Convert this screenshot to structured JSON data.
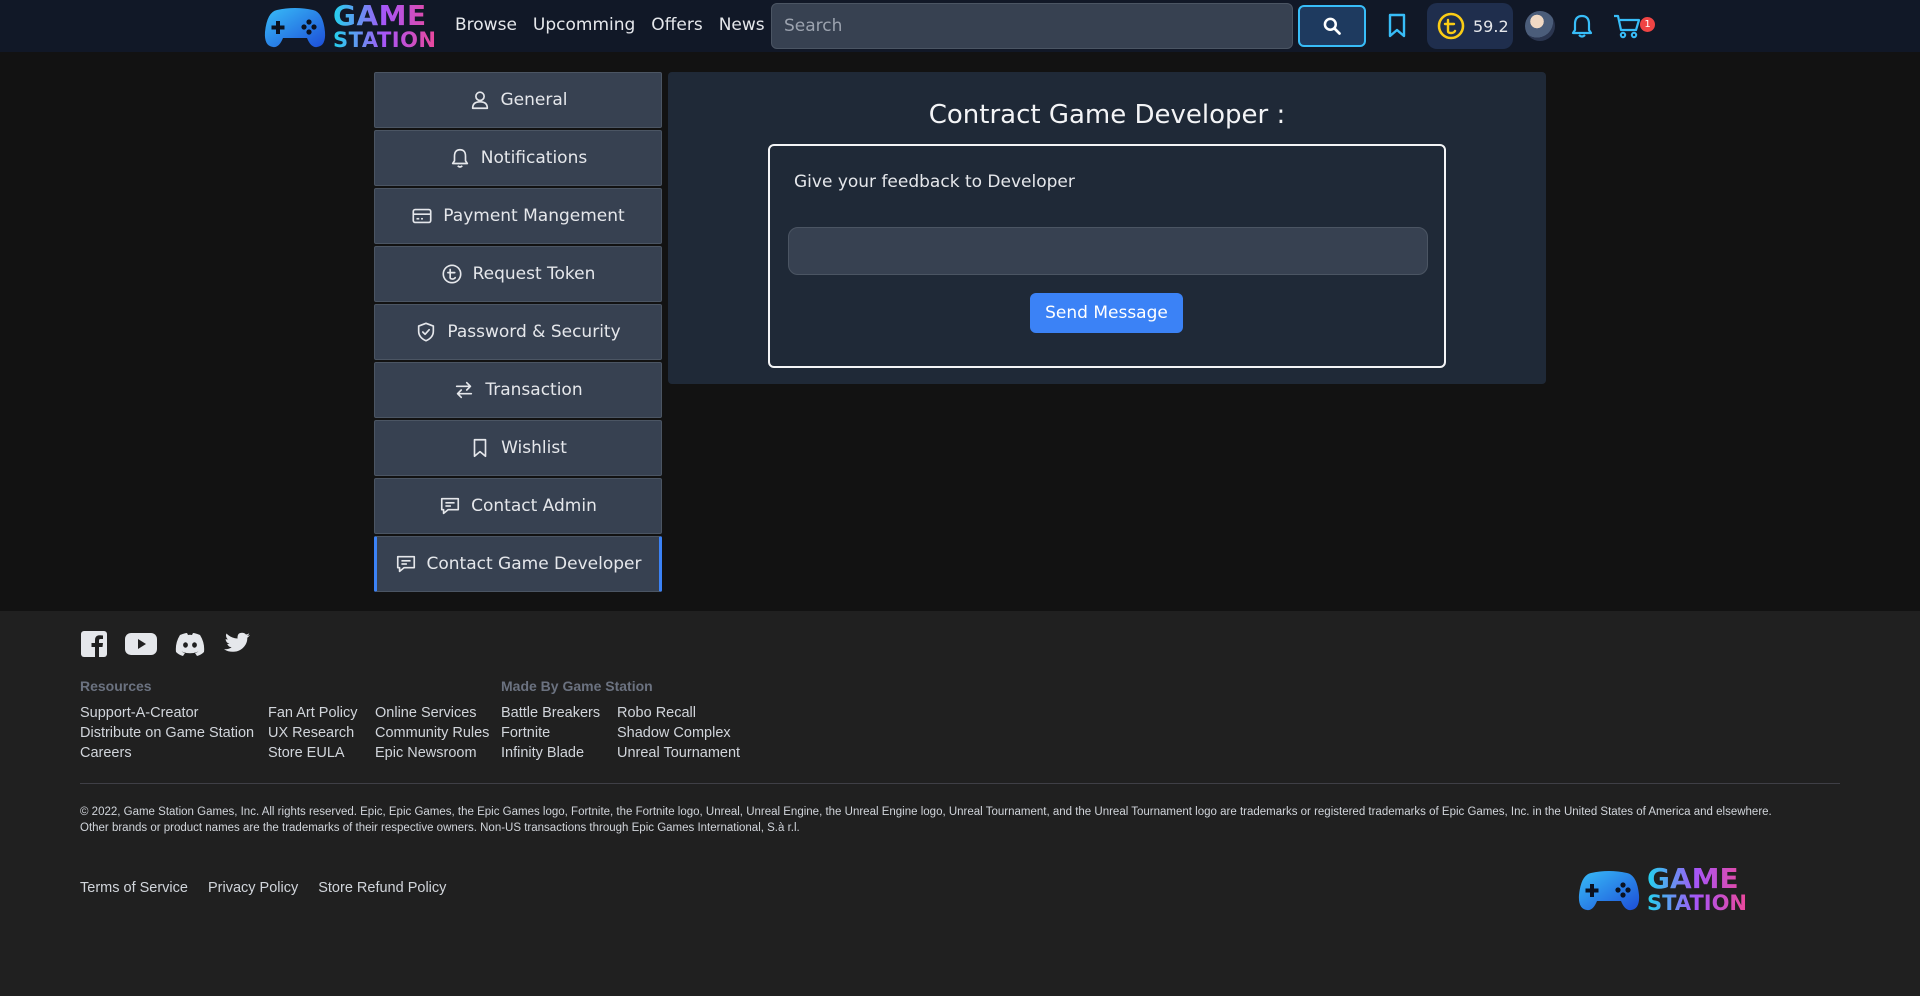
{
  "brand": {
    "line1": "GAME",
    "line2": "STATION"
  },
  "nav": {
    "links": [
      "Browse",
      "Upcomming",
      "Offers",
      "News"
    ],
    "search_placeholder": "Search",
    "token_balance": "59.2",
    "cart_count": "1"
  },
  "sidebar": {
    "items": [
      {
        "label": "General",
        "icon": "user-icon"
      },
      {
        "label": "Notifications",
        "icon": "bell-icon"
      },
      {
        "label": "Payment Mangement",
        "icon": "credit-card-icon"
      },
      {
        "label": "Request Token",
        "icon": "token-icon"
      },
      {
        "label": "Password & Security",
        "icon": "shield-icon"
      },
      {
        "label": "Transaction",
        "icon": "transfer-arrows-icon"
      },
      {
        "label": "Wishlist",
        "icon": "bookmark-icon"
      },
      {
        "label": "Contact Admin",
        "icon": "chat-icon"
      },
      {
        "label": "Contact Game Developer",
        "icon": "chat-icon",
        "active": true
      }
    ]
  },
  "main": {
    "title": "Contract Game Developer :",
    "feedback_label": "Give your feedback to Developer",
    "feedback_value": "",
    "send_label": "Send Message"
  },
  "footer": {
    "resources_heading": "Resources",
    "made_by_heading": "Made By Game Station",
    "resources_col1": [
      "Support-A-Creator",
      "Distribute on Game Station",
      "Careers"
    ],
    "resources_col2": [
      "Fan Art Policy",
      "UX Research",
      "Store EULA"
    ],
    "resources_col3": [
      "Online Services",
      "Community Rules",
      "Epic Newsroom"
    ],
    "made_col1": [
      "Battle Breakers",
      "Fortnite",
      "Infinity Blade"
    ],
    "made_col2": [
      "Robo Recall",
      "Shadow Complex",
      "Unreal Tournament"
    ],
    "legal_text": "© 2022, Game Station Games, Inc. All rights reserved. Epic, Epic Games, the Epic Games logo, Fortnite, the Fortnite logo, Unreal, Unreal Engine, the Unreal Engine logo, Unreal Tournament, and the Unreal Tournament logo are trademarks or registered trademarks of Epic Games, Inc. in the United States of America and elsewhere. Other brands or product names are the trademarks of their respective owners. Non-US transactions through Epic Games International, S.à r.l.",
    "legal_links": [
      "Terms of Service",
      "Privacy Policy",
      "Store Refund Policy"
    ],
    "socials": [
      "facebook-icon",
      "youtube-icon",
      "discord-icon",
      "twitter-icon"
    ]
  },
  "colors": {
    "accent": "#3b82f6",
    "topbar": "#111827",
    "sidebar_item": "#374151",
    "panel": "#1f2937",
    "token_gold": "#facc15",
    "sky": "#38bdf8",
    "badge": "#ef4444"
  }
}
